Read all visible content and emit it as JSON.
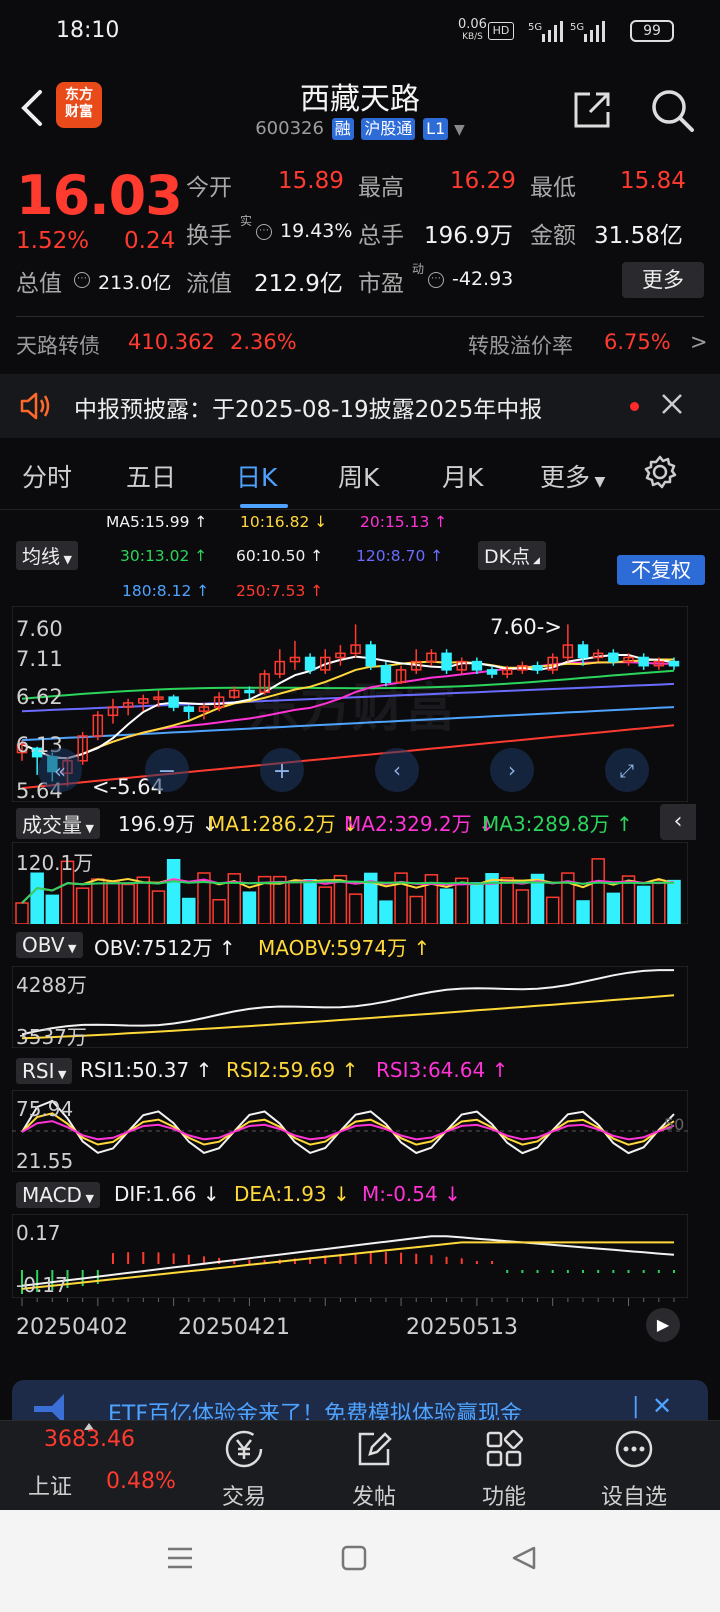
{
  "status": {
    "time": "18:10",
    "net_speed": "0.06",
    "net_unit": "KB/S",
    "hd": "HD",
    "sig1": "5G",
    "sig2": "5G",
    "battery": "99"
  },
  "header": {
    "logo_line1": "东方",
    "logo_line2": "财富",
    "name": "西藏天路",
    "code": "600326",
    "tags": [
      "融",
      "沪股通",
      "L1"
    ]
  },
  "quote": {
    "price": "16.03",
    "change_pct": "1.52%",
    "change_abs": "0.24",
    "open_label": "今开",
    "open": "15.89",
    "high_label": "最高",
    "high": "16.29",
    "low_label": "最低",
    "low": "15.84",
    "turnover_label": "换手",
    "turnover_sup": "实",
    "turnover": "19.43%",
    "volume_label": "总手",
    "volume": "196.9万",
    "amount_label": "金额",
    "amount": "31.58亿",
    "mktcap_label": "总值",
    "mktcap": "213.0亿",
    "float_label": "流值",
    "float": "212.9亿",
    "pe_label": "市盈",
    "pe_sup": "动",
    "pe": "-42.93",
    "more": "更多"
  },
  "bond": {
    "label": "天路转债",
    "price": "410.362",
    "pct": "2.36%",
    "premium_label": "转股溢价率",
    "premium": "6.75%",
    "arrow": ">"
  },
  "notice": {
    "text": "中报预披露：于2025-08-19披露2025年中报"
  },
  "tabs": [
    "分时",
    "五日",
    "日K",
    "周K",
    "月K",
    "更多"
  ],
  "ma_legend": {
    "ma5": "MA5:15.99 ↑",
    "ma10": "10:16.82 ↓",
    "ma20": "20:15.13 ↑",
    "ma30": "30:13.02 ↑",
    "ma60": "60:10.50 ↑",
    "ma120": "120:8.70 ↑",
    "ma180": "180:8.12 ↑",
    "ma250": "250:7.53 ↑",
    "ma_btn": "均线",
    "dk_btn": "DK点",
    "fq_btn": "不复权"
  },
  "colors": {
    "up": "#ff3b30",
    "down": "#33f0ff",
    "ma5": "#ffffff",
    "ma10": "#ffd83a",
    "ma20": "#ff33d6",
    "ma30": "#2bd45b",
    "ma60": "#f2f2f2",
    "ma120": "#6a6cff",
    "ma180": "#4ea3ff",
    "ma250": "#ff3b30"
  },
  "chart_data": [
    {
      "type": "candlestick",
      "y_ticks": [
        "7.60",
        "7.11",
        "6.62",
        "6.13",
        "5.64"
      ],
      "annotations": {
        "max": "7.60->",
        "min": "<-5.64"
      },
      "candles": [
        [
          6.05,
          6.15,
          5.95,
          6.2
        ],
        [
          6.1,
          6.0,
          5.78,
          6.12
        ],
        [
          6.0,
          5.82,
          5.7,
          6.05
        ],
        [
          5.8,
          5.95,
          5.64,
          6.0
        ],
        [
          5.95,
          6.25,
          5.9,
          6.3
        ],
        [
          6.25,
          6.5,
          6.2,
          6.55
        ],
        [
          6.5,
          6.6,
          6.4,
          6.7
        ],
        [
          6.6,
          6.65,
          6.5,
          6.7
        ],
        [
          6.65,
          6.7,
          6.55,
          6.75
        ],
        [
          6.7,
          6.72,
          6.6,
          6.8
        ],
        [
          6.72,
          6.6,
          6.55,
          6.75
        ],
        [
          6.6,
          6.55,
          6.45,
          6.62
        ],
        [
          6.55,
          6.6,
          6.45,
          6.65
        ],
        [
          6.6,
          6.72,
          6.55,
          6.78
        ],
        [
          6.72,
          6.8,
          6.7,
          6.85
        ],
        [
          6.8,
          6.78,
          6.7,
          6.85
        ],
        [
          6.78,
          7.0,
          6.75,
          7.05
        ],
        [
          7.0,
          7.15,
          6.95,
          7.3
        ],
        [
          7.15,
          7.2,
          7.05,
          7.4
        ],
        [
          7.2,
          7.05,
          7.0,
          7.25
        ],
        [
          7.05,
          7.2,
          7.0,
          7.3
        ],
        [
          7.2,
          7.25,
          7.1,
          7.35
        ],
        [
          7.25,
          7.35,
          7.2,
          7.6
        ],
        [
          7.35,
          7.1,
          7.05,
          7.4
        ],
        [
          7.1,
          6.9,
          6.85,
          7.15
        ],
        [
          6.9,
          7.05,
          6.88,
          7.1
        ],
        [
          7.05,
          7.15,
          7.0,
          7.3
        ],
        [
          7.15,
          7.25,
          7.1,
          7.3
        ],
        [
          7.25,
          7.05,
          7.0,
          7.3
        ],
        [
          7.05,
          7.15,
          7.0,
          7.2
        ],
        [
          7.15,
          7.05,
          7.0,
          7.2
        ],
        [
          7.05,
          7.0,
          6.95,
          7.1
        ],
        [
          7.0,
          7.05,
          6.95,
          7.1
        ],
        [
          7.05,
          7.1,
          7.0,
          7.15
        ],
        [
          7.1,
          7.05,
          7.0,
          7.15
        ],
        [
          7.05,
          7.2,
          7.0,
          7.25
        ],
        [
          7.2,
          7.35,
          7.15,
          7.6
        ],
        [
          7.35,
          7.2,
          7.1,
          7.4
        ],
        [
          7.2,
          7.25,
          7.15,
          7.3
        ],
        [
          7.25,
          7.15,
          7.1,
          7.3
        ],
        [
          7.15,
          7.2,
          7.1,
          7.25
        ],
        [
          7.2,
          7.1,
          7.05,
          7.25
        ],
        [
          7.1,
          7.15,
          7.05,
          7.2
        ],
        [
          7.15,
          7.1,
          7.05,
          7.2
        ]
      ]
    },
    {
      "type": "bar",
      "name": "成交量",
      "legend": {
        "sel": "成交量",
        "v": "196.9万 ↓",
        "ma1": "MA1:286.2万 ↓",
        "ma2": "MA2:329.2万 ↓",
        "ma3": "MA3:289.8万 ↑"
      },
      "y_tick": "120.1万"
    },
    {
      "type": "line",
      "name": "OBV",
      "legend": {
        "sel": "OBV",
        "obv": "OBV:7512万 ↑",
        "maobv": "MAOBV:5974万 ↑"
      },
      "y_ticks": [
        "4288万",
        "3537万"
      ]
    },
    {
      "type": "line",
      "name": "RSI",
      "legend": {
        "sel": "RSI",
        "r1": "RSI1:50.37 ↑",
        "r2": "RSI2:59.69 ↑",
        "r3": "RSI3:64.64 ↑"
      },
      "y_ticks": [
        "75.94",
        "21.55"
      ],
      "ref": "50"
    },
    {
      "type": "bar",
      "name": "MACD",
      "legend": {
        "sel": "MACD",
        "dif": "DIF:1.66 ↓",
        "dea": "DEA:1.93 ↓",
        "m": "M:-0.54 ↓"
      },
      "y_ticks": [
        "0.17",
        "-0.17"
      ]
    },
    {
      "type": "axis",
      "x_labels": [
        "20250402",
        "20250421",
        "20250513"
      ]
    }
  ],
  "banner": {
    "text": "ETF百亿体验金来了！免费模拟体验赢现金"
  },
  "bottom": {
    "index_value": "3683.46",
    "index_name": "上证",
    "index_pct": "0.48%",
    "items": [
      "交易",
      "发帖",
      "功能",
      "设自选"
    ]
  }
}
